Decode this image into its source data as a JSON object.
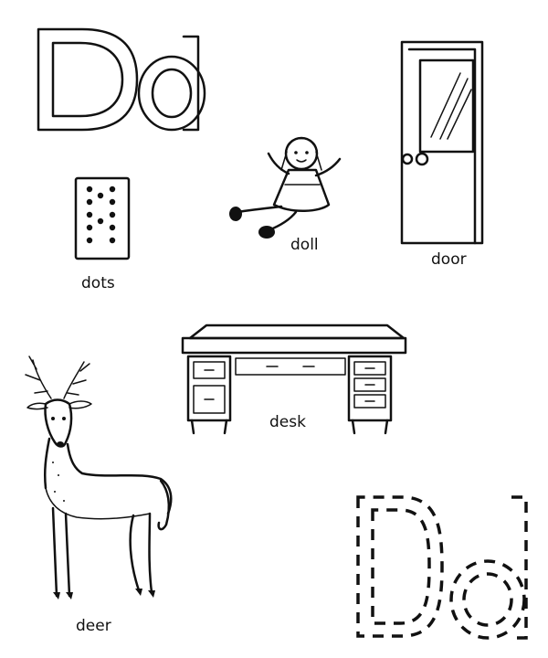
{
  "heading": {
    "upper": "D",
    "lower": "d"
  },
  "trace": {
    "upper": "D",
    "lower": "d"
  },
  "pictures": {
    "dots": {
      "label": "dots",
      "icon": "dots-card-icon"
    },
    "doll": {
      "label": "doll",
      "icon": "doll-icon"
    },
    "door": {
      "label": "door",
      "icon": "door-icon"
    },
    "desk": {
      "label": "desk",
      "icon": "desk-icon"
    },
    "deer": {
      "label": "deer",
      "icon": "deer-icon"
    }
  },
  "colors": {
    "ink": "#111111",
    "paper": "#ffffff"
  }
}
